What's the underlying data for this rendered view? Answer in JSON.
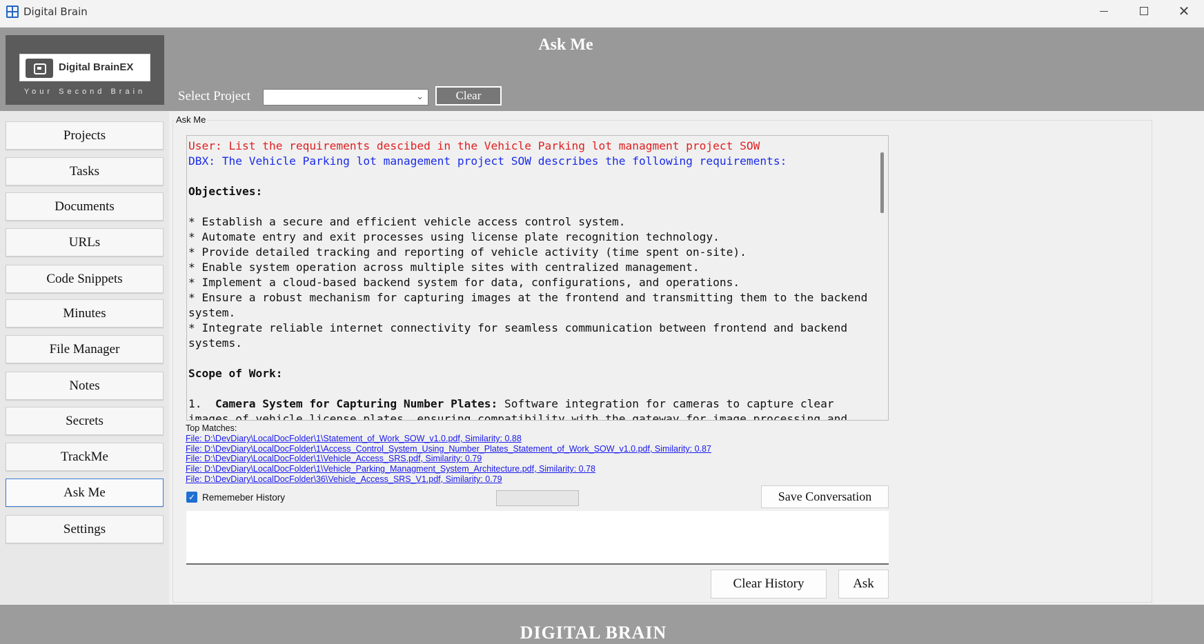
{
  "window": {
    "title": "Digital Brain"
  },
  "logo": {
    "name": "Digital BrainEX",
    "tagline": "Your Second Brain"
  },
  "header": {
    "title": "Ask Me",
    "select_project_label": "Select Project",
    "selected_project": "",
    "clear_label": "Clear"
  },
  "sidebar": {
    "items": [
      {
        "label": "Projects"
      },
      {
        "label": "Tasks"
      },
      {
        "label": "Documents"
      },
      {
        "label": "URLs"
      },
      {
        "label": "Code Snippets"
      },
      {
        "label": "Minutes"
      },
      {
        "label": "File Manager"
      },
      {
        "label": "Notes"
      },
      {
        "label": "Secrets"
      },
      {
        "label": "TrackMe"
      },
      {
        "label": "Ask Me",
        "active": true
      },
      {
        "label": "Settings"
      }
    ]
  },
  "main": {
    "group_label": "Ask Me",
    "conversation": {
      "user_line": "User: List the requirements descibed in the Vehicle Parking lot managment project SOW",
      "dbx_line": "DBX: The Vehicle Parking lot management project SOW describes the following requirements:",
      "objectives_heading": "Objectives:",
      "objectives": [
        "* Establish a secure and efficient vehicle access control system.",
        "* Automate entry and exit processes using license plate recognition technology.",
        "* Provide detailed tracking and reporting of vehicle activity (time spent on-site).",
        "* Enable system operation across multiple sites with centralized management.",
        "* Implement a cloud-based backend system for data, configurations, and operations.",
        "* Ensure a robust mechanism for capturing images at the frontend and transmitting them to the backend system.",
        "* Integrate reliable internet connectivity for seamless communication between frontend and backend systems."
      ],
      "scope_heading": "Scope of Work:",
      "scope_item_number": "1.  ",
      "scope_item_title": "Camera System for Capturing Number Plates:",
      "scope_item_text": " Software integration for cameras to capture clear images of vehicle license plates, ensuring compatibility with the gateway for image processing and"
    },
    "top_matches_label": "Top Matches:",
    "top_matches": [
      "File: D:\\DevDiary\\LocalDocFolder\\1\\Statement_of_Work_SOW_v1.0.pdf, Similarity: 0.88",
      "File: D:\\DevDiary\\LocalDocFolder\\1\\Access_Control_System_Using_Number_Plates_Statement_of_Work_SOW_v1.0.pdf, Similarity: 0.87",
      "File: D:\\DevDiary\\LocalDocFolder\\1\\Vehicle_Access_SRS.pdf, Similarity: 0.79",
      "File: D:\\DevDiary\\LocalDocFolder\\1\\Vehicle_Parking_Managment_System_Architecture.pdf, Similarity: 0.78",
      "File: D:\\DevDiary\\LocalDocFolder\\36\\Vehicle_Access_SRS_V1.pdf, Similarity: 0.79"
    ],
    "remember_history_label": "Rememeber History",
    "remember_history_checked": true,
    "save_conversation_label": "Save Conversation",
    "question_value": "",
    "clear_history_label": "Clear History",
    "ask_label": "Ask"
  },
  "footer": {
    "text": "DIGITAL BRAIN"
  },
  "colors": {
    "header_bg": "#999999",
    "user_text": "#e02020",
    "dbx_text": "#1a2be8",
    "link": "#1a1aee",
    "checkbox": "#1f6fd1"
  }
}
